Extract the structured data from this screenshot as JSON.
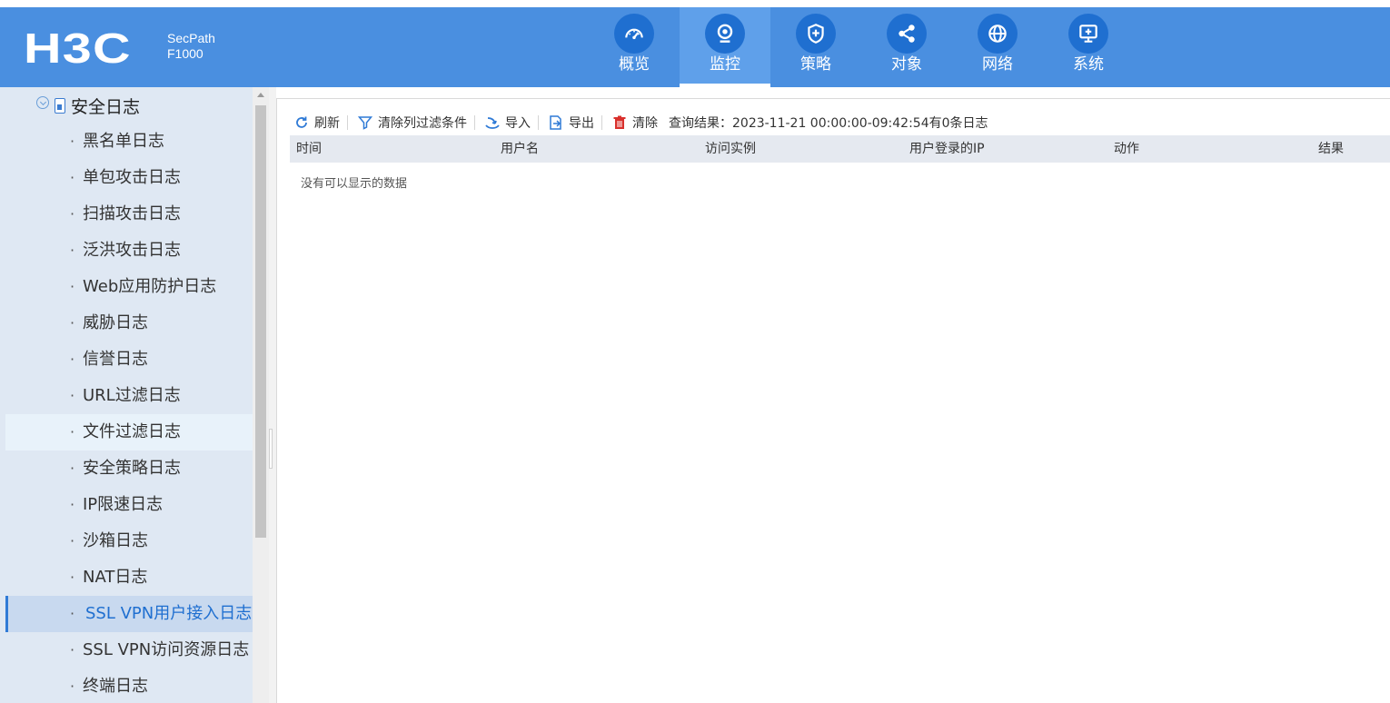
{
  "brand": {
    "logo": "H3C",
    "product_line1": "SecPath",
    "product_line2": "F1000"
  },
  "nav": [
    {
      "label": "概览",
      "icon": "dashboard-icon",
      "active": false
    },
    {
      "label": "监控",
      "icon": "monitor-camera-icon",
      "active": true
    },
    {
      "label": "策略",
      "icon": "shield-plus-icon",
      "active": false
    },
    {
      "label": "对象",
      "icon": "share-nodes-icon",
      "active": false
    },
    {
      "label": "网络",
      "icon": "globe-icon",
      "active": false
    },
    {
      "label": "系统",
      "icon": "system-display-icon",
      "active": false
    }
  ],
  "sidebar": {
    "root_label": "安全日志",
    "items": [
      {
        "label": "黑名单日志"
      },
      {
        "label": "单包攻击日志"
      },
      {
        "label": "扫描攻击日志"
      },
      {
        "label": "泛洪攻击日志"
      },
      {
        "label": "Web应用防护日志"
      },
      {
        "label": "威胁日志"
      },
      {
        "label": "信誉日志"
      },
      {
        "label": "URL过滤日志"
      },
      {
        "label": "文件过滤日志",
        "state": "hover"
      },
      {
        "label": "安全策略日志"
      },
      {
        "label": "IP限速日志"
      },
      {
        "label": "沙箱日志"
      },
      {
        "label": "NAT日志"
      },
      {
        "label": "SSL VPN用户接入日志",
        "state": "selected"
      },
      {
        "label": "SSL VPN访问资源日志"
      },
      {
        "label": "终端日志"
      }
    ]
  },
  "toolbar": {
    "refresh": "刷新",
    "clear_filter": "清除列过滤条件",
    "import": "导入",
    "export": "导出",
    "clear": "清除",
    "query_result": "查询结果：2023-11-21 00:00:00-09:42:54有0条日志"
  },
  "table": {
    "columns": [
      "时间",
      "用户名",
      "访问实例",
      "用户登录的IP",
      "动作",
      "结果"
    ],
    "rows": [],
    "empty_message": "没有可以显示的数据"
  },
  "colors": {
    "header": "#4a8fe0",
    "accent": "#1f6fd0",
    "sidebar": "#dfe8f3",
    "selected": "#c8d9ef"
  }
}
